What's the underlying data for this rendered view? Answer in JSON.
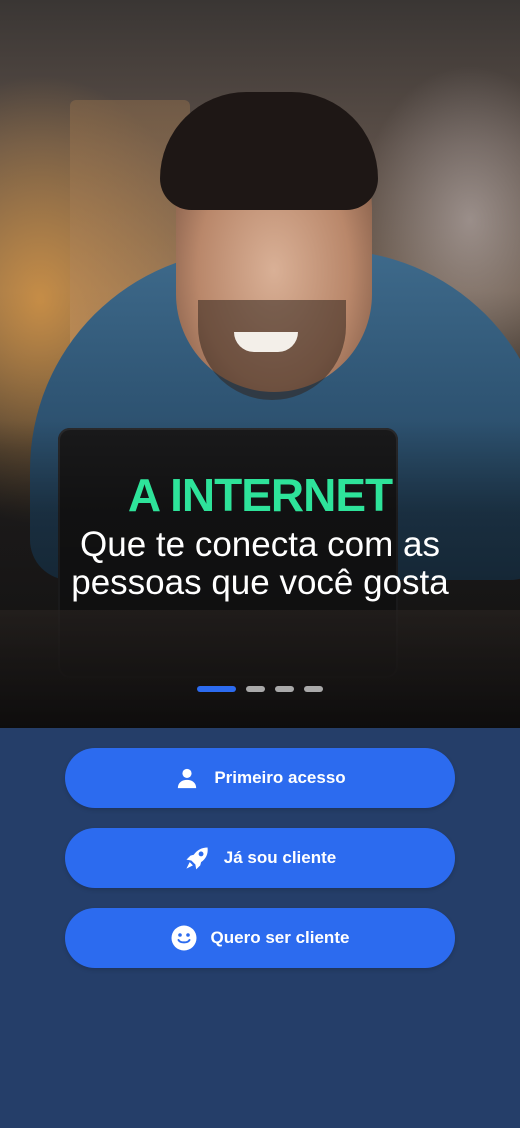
{
  "hero": {
    "headline": "A INTERNET",
    "subtitle": "Que te conecta com as pessoas que você gosta"
  },
  "carousel": {
    "total": 4,
    "active_index": 0
  },
  "buttons": {
    "first_access": {
      "label": "Primeiro acesso",
      "icon": "user-icon"
    },
    "already_client": {
      "label": "Já sou cliente",
      "icon": "rocket-icon"
    },
    "want_client": {
      "label": "Quero ser cliente",
      "icon": "smile-icon"
    }
  },
  "colors": {
    "accent": "#2c6bef",
    "headline": "#2ee39a",
    "panel": "#253e69"
  }
}
